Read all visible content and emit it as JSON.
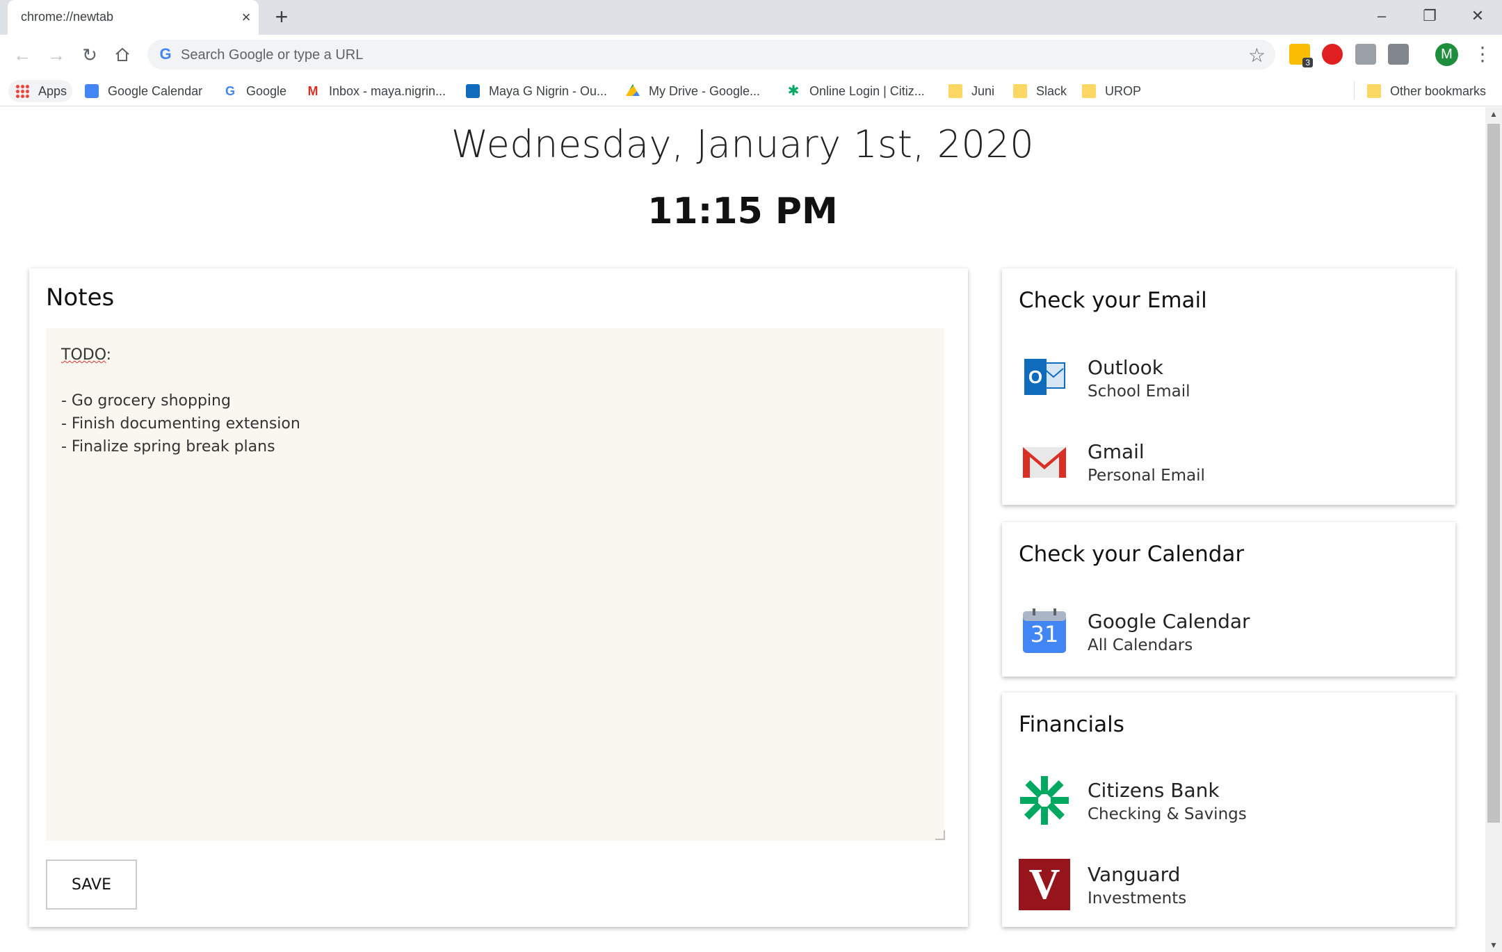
{
  "browser": {
    "tab_title": "chrome://newtab",
    "tab_close_icon": "×",
    "new_tab_icon": "+",
    "minimize_icon": "–",
    "restore_icon": "❐",
    "close_window_icon": "✕",
    "omnibox_placeholder": "Search Google or type a URL",
    "omnibox_g": "G",
    "avatar_letter": "M",
    "extension_badge": "3"
  },
  "bookmarks": {
    "items": [
      {
        "label": "Apps"
      },
      {
        "label": "Google Calendar"
      },
      {
        "label": "Google"
      },
      {
        "label": "Inbox - maya.nigrin..."
      },
      {
        "label": "Maya G Nigrin - Ou..."
      },
      {
        "label": "My Drive - Google..."
      },
      {
        "label": "Online Login | Citiz..."
      },
      {
        "label": "Juni"
      },
      {
        "label": "Slack"
      },
      {
        "label": "UROP"
      }
    ],
    "other": "Other bookmarks"
  },
  "page": {
    "date": "Wednesday, January 1st, 2020",
    "time": "11:15 PM"
  },
  "notes": {
    "title": "Notes",
    "todo_word": "TODO",
    "todo_suffix": ":",
    "lines": [
      "",
      "- Go grocery shopping",
      "- Finish documenting extension",
      "- Finalize spring break plans"
    ],
    "save_label": "SAVE"
  },
  "email": {
    "title": "Check your Email",
    "links": [
      {
        "name": "Outlook",
        "sub": "School Email"
      },
      {
        "name": "Gmail",
        "sub": "Personal Email"
      }
    ]
  },
  "calendar": {
    "title": "Check your Calendar",
    "links": [
      {
        "name": "Google Calendar",
        "sub": "All Calendars",
        "icon_text": "31"
      }
    ]
  },
  "financials": {
    "title": "Financials",
    "links": [
      {
        "name": "Citizens Bank",
        "sub": "Checking & Savings"
      },
      {
        "name": "Vanguard",
        "sub": "Investments",
        "icon_text": "V"
      }
    ]
  },
  "colors": {
    "outlook_blue": "#0f6cbd",
    "gmail_red": "#d93025",
    "calendar_blue": "#4285f4",
    "citizens_green": "#00a862",
    "vanguard_red": "#96151d",
    "notes_bg": "#faf7f0"
  }
}
